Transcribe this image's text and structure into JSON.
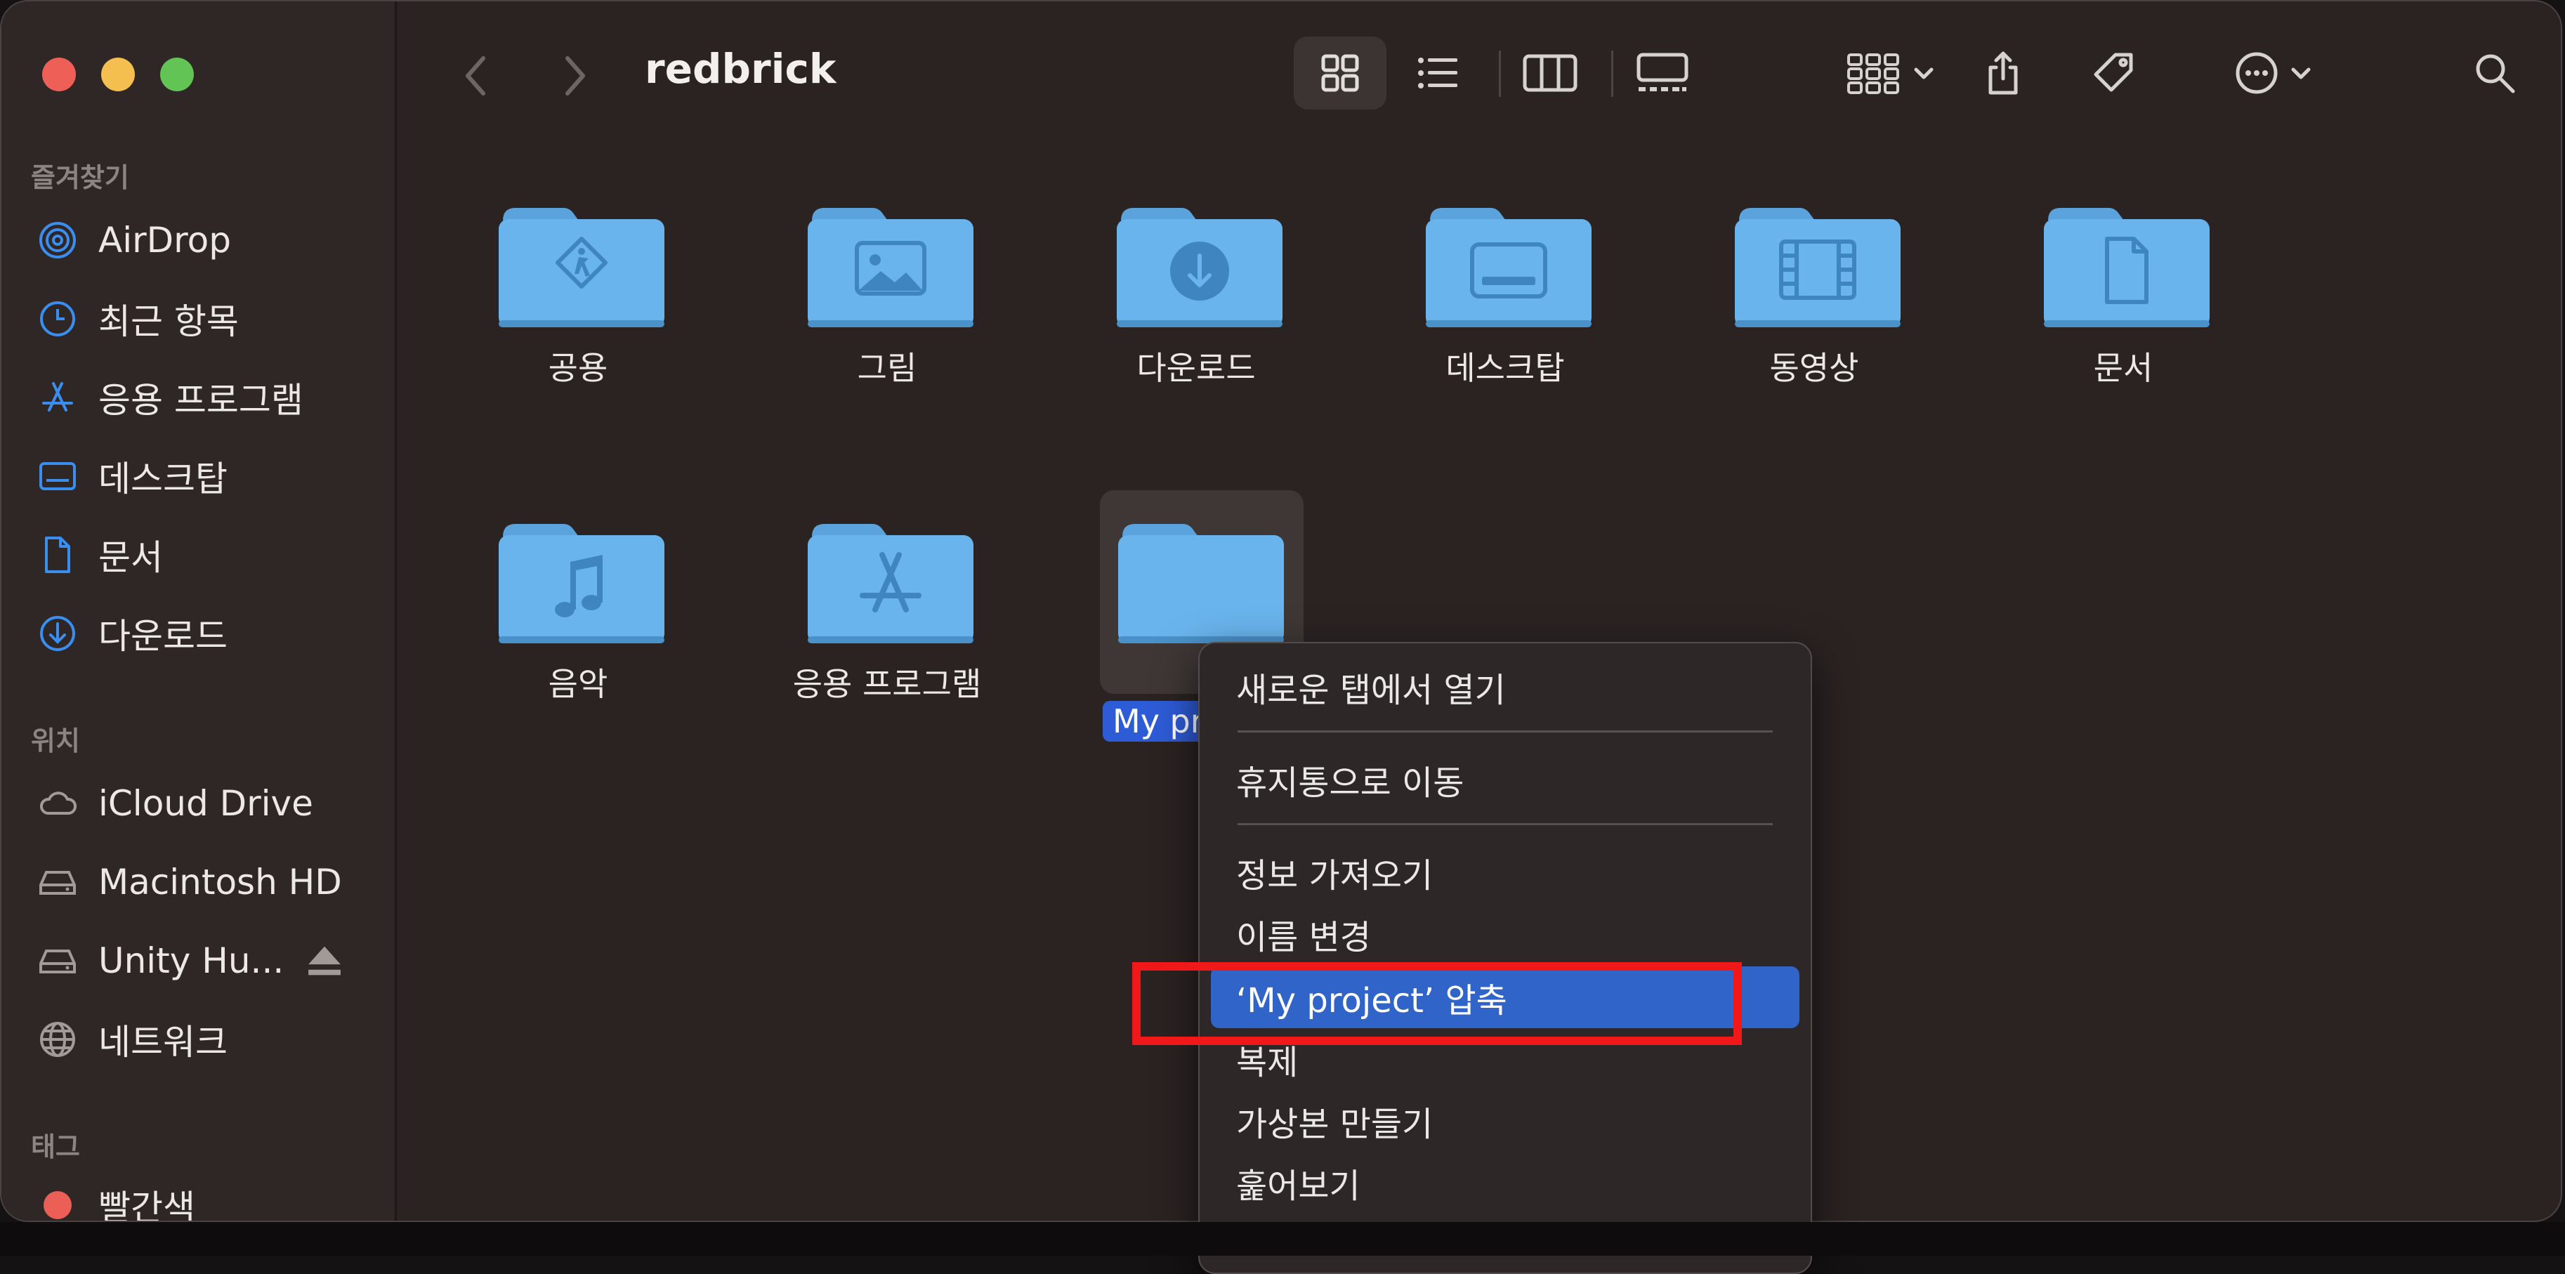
{
  "window": {
    "title": "redbrick"
  },
  "sidebar": {
    "favorites_title": "즐겨찾기",
    "favorites": [
      {
        "label": "AirDrop",
        "icon": "airdrop-icon"
      },
      {
        "label": "최근 항목",
        "icon": "clock-icon"
      },
      {
        "label": "응용 프로그램",
        "icon": "applications-icon"
      },
      {
        "label": "데스크탑",
        "icon": "desktop-icon"
      },
      {
        "label": "문서",
        "icon": "document-icon"
      },
      {
        "label": "다운로드",
        "icon": "download-icon"
      }
    ],
    "locations_title": "위치",
    "locations": [
      {
        "label": "iCloud Drive",
        "icon": "cloud-icon"
      },
      {
        "label": "Macintosh HD",
        "icon": "drive-icon"
      },
      {
        "label": "Unity Hu...",
        "icon": "drive-icon"
      },
      {
        "label": "네트워크",
        "icon": "globe-icon"
      }
    ],
    "tags_title": "태그",
    "tags": [
      {
        "label": "빨간색",
        "color": "#ec5f57"
      }
    ]
  },
  "files": [
    {
      "label": "공용",
      "icon": "public-folder-icon"
    },
    {
      "label": "그림",
      "icon": "pictures-folder-icon"
    },
    {
      "label": "다운로드",
      "icon": "downloads-folder-icon"
    },
    {
      "label": "데스크탑",
      "icon": "desktop-folder-icon"
    },
    {
      "label": "동영상",
      "icon": "movies-folder-icon"
    },
    {
      "label": "문서",
      "icon": "documents-folder-icon"
    },
    {
      "label": "음악",
      "icon": "music-folder-icon"
    },
    {
      "label": "응용 프로그램",
      "icon": "applications-folder-icon"
    },
    {
      "label": "My pr",
      "icon": "folder-icon",
      "selected": true
    }
  ],
  "context_menu": {
    "items": [
      "새로운 탭에서 열기",
      "휴지통으로 이동",
      "정보 가져오기",
      "이름 변경",
      "‘My project’ 압축",
      "복제",
      "가상본 만들기",
      "훑어보기"
    ],
    "highlighted": "‘My project’ 압축"
  },
  "colors": {
    "folder": "#69b4ec",
    "folder_tab": "#5aa3dc",
    "accent": "#3064c8",
    "annotation": "#f01818"
  }
}
